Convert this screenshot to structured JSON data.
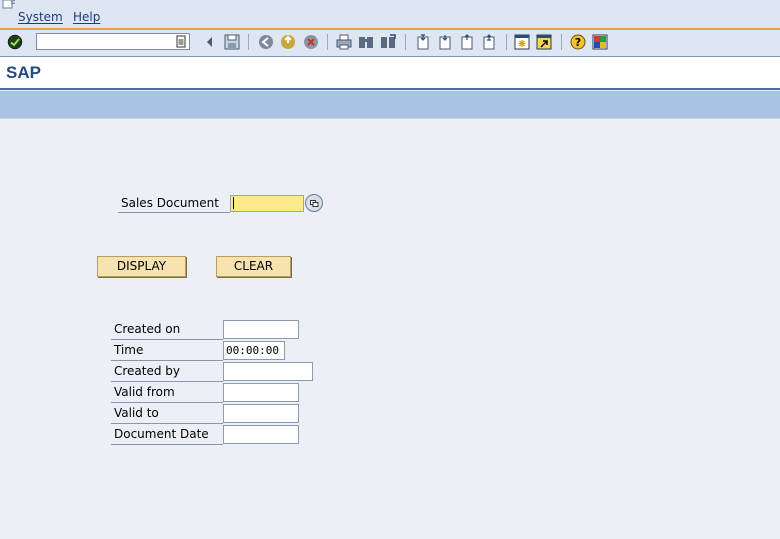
{
  "menu": {
    "system": "System",
    "help": "Help"
  },
  "command_field": {
    "value": ""
  },
  "title": "SAP",
  "sales_document": {
    "label": "Sales Document",
    "value": ""
  },
  "buttons": {
    "display": "DISPLAY",
    "clear": "CLEAR"
  },
  "fields": [
    {
      "label": "Created on",
      "value": ""
    },
    {
      "label": "Time",
      "value": "00:00:00"
    },
    {
      "label": "Created by",
      "value": ""
    },
    {
      "label": "Valid from",
      "value": ""
    },
    {
      "label": "Valid to",
      "value": ""
    },
    {
      "label": "Document Date",
      "value": ""
    }
  ],
  "toolbar_icons": [
    "enter-icon",
    "back-arrow-icon",
    "save-icon",
    "back-icon",
    "exit-icon",
    "cancel-icon",
    "print-icon",
    "find-icon",
    "find-next-icon",
    "first-page-icon",
    "previous-page-icon",
    "next-page-icon",
    "last-page-icon",
    "create-session-icon",
    "shortcut-icon",
    "help-icon",
    "layout-menu-icon"
  ],
  "colors": {
    "accent": "#e8a33a",
    "title": "#234a82",
    "app_toolbar": "#a9c3e2",
    "required_input": "#fbe98a",
    "button": "#f6e3b0"
  }
}
